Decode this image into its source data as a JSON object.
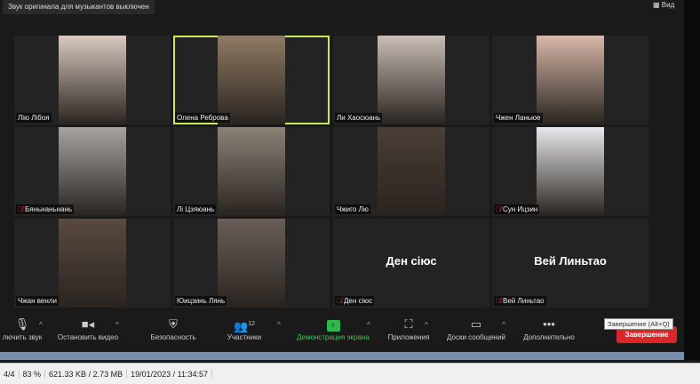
{
  "banner": "Звук оригинала для музыкантов выключен",
  "view_label": "Вид",
  "tiles": [
    {
      "name": "Лію Лібоя",
      "muted": false,
      "video": true,
      "color": "#d9c9c0"
    },
    {
      "name": "Олена Реброва",
      "muted": false,
      "video": true,
      "active": true,
      "color": "#8f7a64"
    },
    {
      "name": "Ли Хаосюань",
      "muted": false,
      "video": true,
      "color": "#c9bdb6"
    },
    {
      "name": "Чжен Ланьюе",
      "muted": false,
      "video": true,
      "color": "#d8b8a8"
    },
    {
      "name": "Бяньнаньнань",
      "muted": true,
      "video": true,
      "color": "#a9a39f"
    },
    {
      "name": "Лі Цзяюань",
      "muted": false,
      "video": true,
      "color": "#8c8278"
    },
    {
      "name": "Чжиго Лю",
      "muted": false,
      "video": true,
      "color": "#4a3e36"
    },
    {
      "name": "Сун Ицзин",
      "muted": true,
      "video": true,
      "color": "#e8e8ec"
    },
    {
      "name": "Чжан венли",
      "muted": false,
      "video": true,
      "color": "#5a4a40"
    },
    {
      "name": "Юицзинь Лянь",
      "muted": false,
      "video": true,
      "color": "#6a5f58"
    },
    {
      "name": "Ден сіюс",
      "muted": true,
      "video": false
    },
    {
      "name": "Вей Линьтао",
      "muted": true,
      "video": false
    }
  ],
  "toolbar": {
    "mute": "лючить звук",
    "video": "Остановить видео",
    "security": "Безопасность",
    "participants": "Участники",
    "participants_count": "12",
    "share": "Демонстрация экрана",
    "apps": "Приложения",
    "whiteboards": "Доски сообщений",
    "more": "Дополнительно",
    "end": "Завершение",
    "end_tooltip": "Завершение (Alt+Q)"
  },
  "status": {
    "page": "4/4",
    "zoom": "83 %",
    "size": "621.33 KB / 2.73 MB",
    "datetime": "19/01/2023 / 11:34:57"
  }
}
